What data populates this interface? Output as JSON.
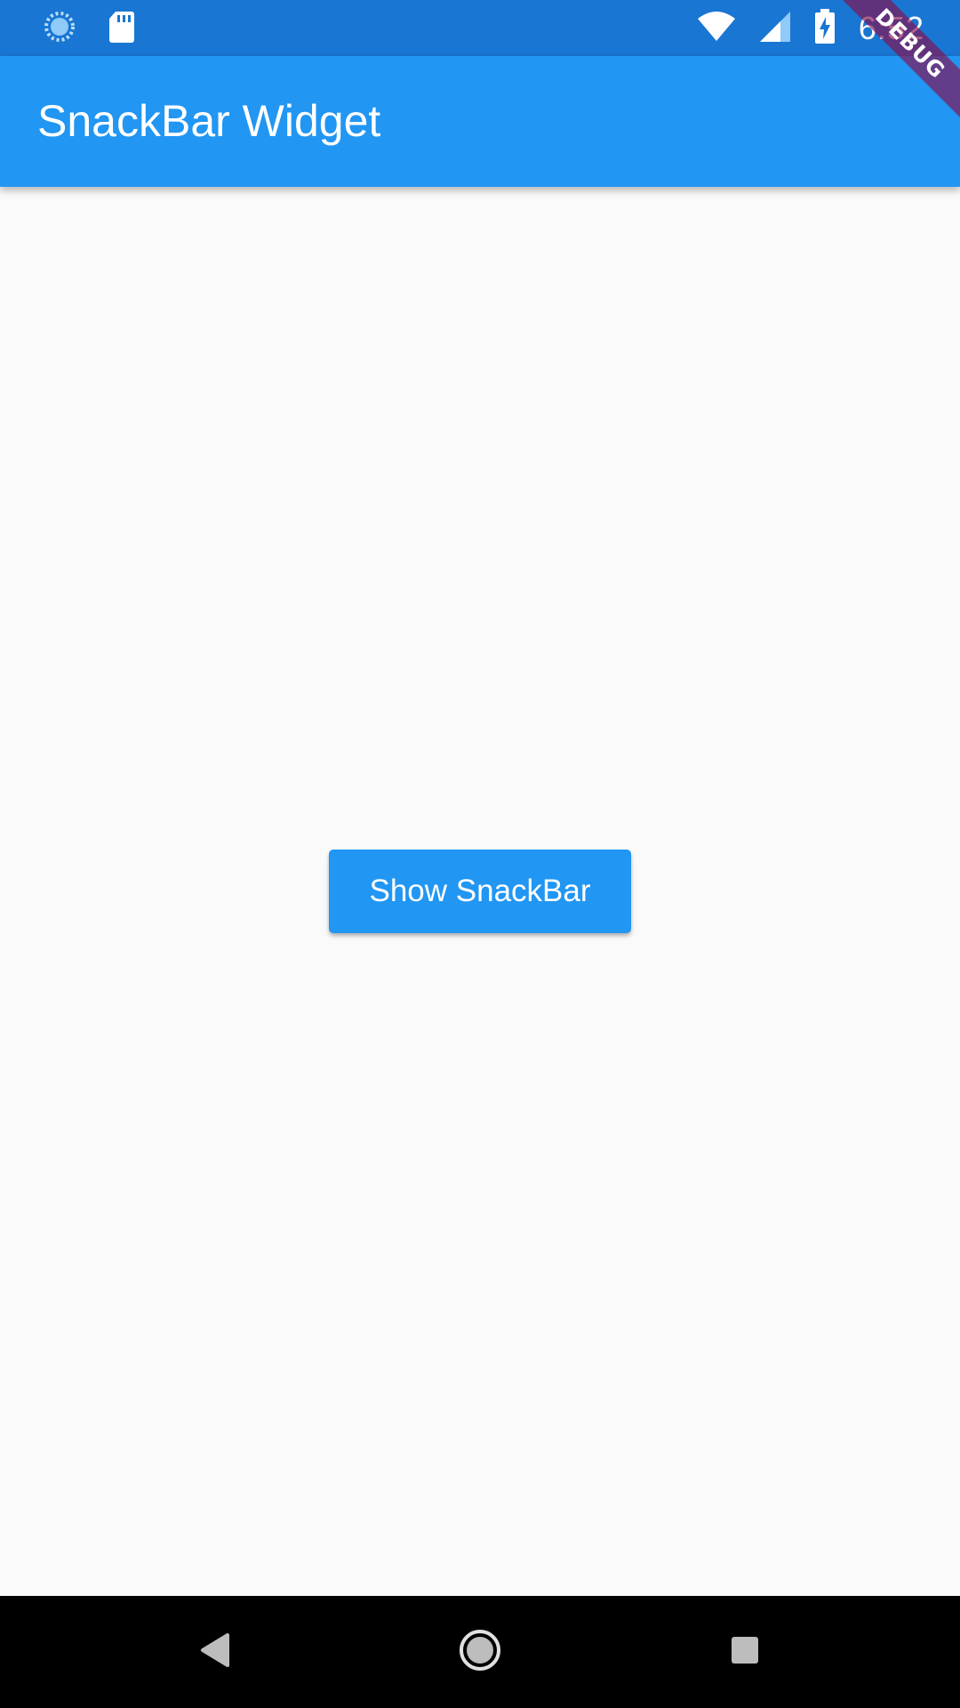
{
  "status_bar": {
    "time": "6:52",
    "icons": [
      "loading-icon",
      "sd-card-icon",
      "wifi-icon",
      "signal-icon",
      "battery-charging-icon"
    ],
    "background": "#1976d2"
  },
  "app_bar": {
    "title": "SnackBar Widget",
    "background": "#2196f3"
  },
  "debug_banner": {
    "label": "DEBUG"
  },
  "main": {
    "button_label": "Show SnackBar",
    "button_color": "#2196f3",
    "background": "#fafafa"
  },
  "nav_bar": {
    "icons": [
      "back-icon",
      "home-icon",
      "recents-icon"
    ]
  }
}
